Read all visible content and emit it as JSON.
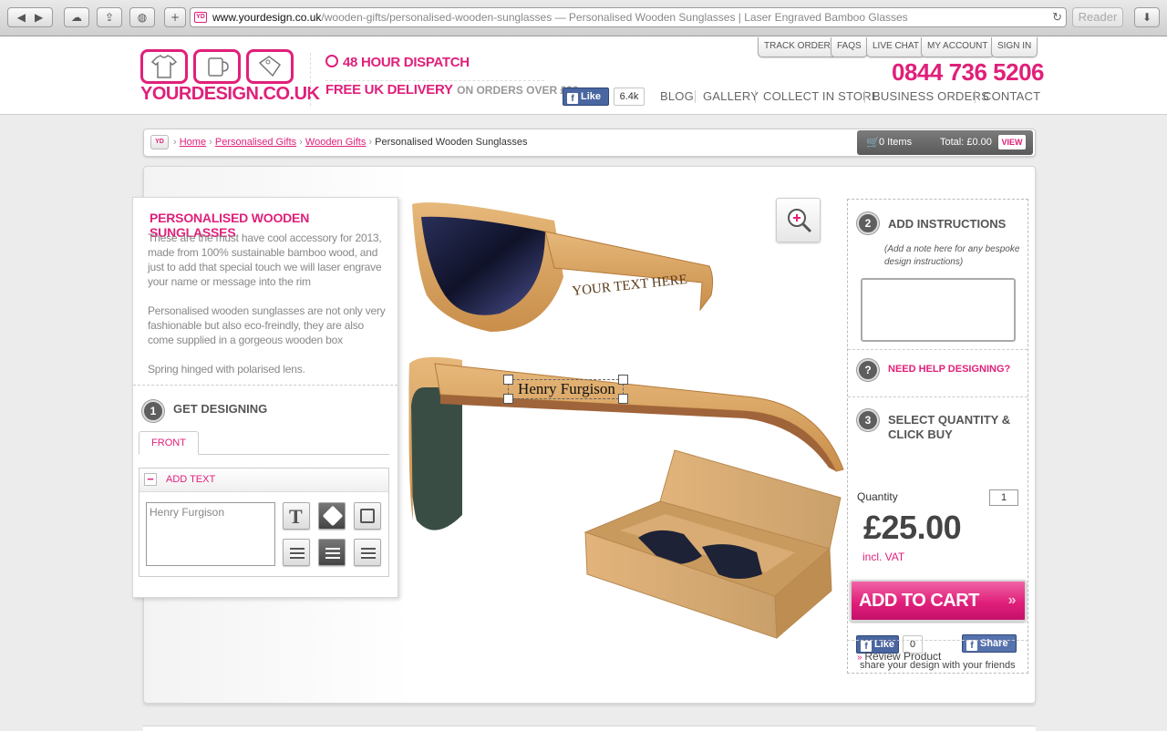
{
  "browser": {
    "url_host": "www.yourdesign.co.uk",
    "url_path": "/wooden-gifts/personalised-wooden-sunglasses",
    "page_title": "— Personalised Wooden Sunglasses | Laser Engraved Bamboo Glasses",
    "favicon_text": "YD",
    "reader_label": "Reader"
  },
  "header": {
    "logo_text": "YOURDESIGN.CO.UK",
    "dispatch": "48 HOUR DISPATCH",
    "delivery_main": "FREE UK DELIVERY",
    "delivery_sub": "ON ORDERS OVER £30",
    "fb_like": "Like",
    "fb_count": "6.4k",
    "phone": "0844 736 5206",
    "top_links": [
      "TRACK ORDER",
      "FAQS",
      "LIVE CHAT",
      "MY ACCOUNT",
      "SIGN IN"
    ],
    "main_nav": [
      "BLOG",
      "GALLERY",
      "COLLECT IN STORE",
      "BUSINESS ORDERS",
      "CONTACT"
    ]
  },
  "breadcrumb": {
    "icon_text": "YD",
    "items": [
      "Home",
      "Personalised Gifts",
      "Wooden Gifts"
    ],
    "current": "Personalised Wooden Sunglasses"
  },
  "cart": {
    "items": "0 Items",
    "total": "Total: £0.00",
    "view": "VIEW"
  },
  "product": {
    "title": "PERSONALISED WOODEN SUNGLASSES",
    "desc1": "These are the must have cool accessory for 2013, made from 100% sustainable bamboo wood, and just to add that special touch we will laser engrave your name or message into the rim",
    "desc2": "Personalised wooden sunglasses are not only very fashionable but also eco-freindly, they are also come supplied in a gorgeous wooden box",
    "desc3": "Spring hinged with polarised lens.",
    "engraving_sample": "YOUR TEXT HERE",
    "engraving_text": "Henry Furgison"
  },
  "designer": {
    "step1_num": "1",
    "step1_label": "GET DESIGNING",
    "tab_front": "FRONT",
    "add_text_label": "ADD TEXT",
    "add_text_toggle": "−",
    "text_value": "Henry Furgison"
  },
  "order": {
    "step2_num": "2",
    "step2_label": "ADD INSTRUCTIONS",
    "instructions_hint": "(Add a note here for any bespoke design instructions)",
    "help_icon": "?",
    "help_label": "NEED HELP DESIGNING?",
    "step3_num": "3",
    "step3_label": "SELECT QUANTITY & CLICK BUY",
    "quantity_label": "Quantity",
    "quantity_value": "1",
    "price": "£25.00",
    "vat": "incl. VAT",
    "add_to_cart": "ADD TO CART",
    "fb_like": "Like",
    "fb_like_count": "0",
    "fb_share": "Share",
    "share_text": "share your design with your friends",
    "review": "Review Product"
  },
  "colors": {
    "brand": "#e0207a",
    "dark_step": "#5e5e5e",
    "facebook": "#4a66a0"
  }
}
